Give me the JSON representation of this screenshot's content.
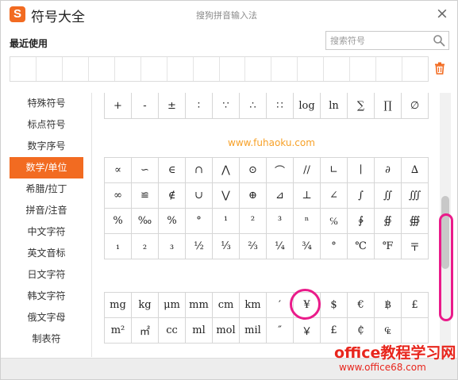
{
  "window": {
    "logo_letter": "S",
    "title": "符号大全",
    "subtitle": "搜狗拼音输入法",
    "close_symbol": "×"
  },
  "recent": {
    "label": "最近使用",
    "search_placeholder": "搜索符号"
  },
  "sidebar": {
    "items": [
      {
        "label": "特殊符号"
      },
      {
        "label": "标点符号"
      },
      {
        "label": "数字序号"
      },
      {
        "label": "数学/单位",
        "active": true
      },
      {
        "label": "希腊/拉丁"
      },
      {
        "label": "拼音/注音"
      },
      {
        "label": "中文字符"
      },
      {
        "label": "英文音标"
      },
      {
        "label": "日文字符"
      },
      {
        "label": "韩文字符"
      },
      {
        "label": "俄文字母"
      },
      {
        "label": "制表符"
      }
    ]
  },
  "symbols": {
    "row_a": [
      "+",
      "-",
      "±",
      "∶",
      "∵",
      "∴",
      "∷",
      "log",
      "ln",
      "∑",
      "∏",
      "∅"
    ],
    "watermark": "www.fuhaoku.com",
    "rows_b": [
      [
        "∝",
        "∽",
        "∈",
        "∩",
        "⋀",
        "⊙",
        "⌒",
        "//",
        "∟",
        "∣",
        "∂",
        "∆"
      ],
      [
        "∞",
        "≌",
        "∉",
        "∪",
        "⋁",
        "⊕",
        "⊿",
        "⊥",
        "∠",
        "∫",
        "∬",
        "∭"
      ],
      [
        "%",
        "‰",
        "%",
        "°",
        "¹",
        "²",
        "³",
        "ⁿ",
        "℅",
        "∲",
        "∯",
        "∰"
      ],
      [
        "₁",
        "₂",
        "₃",
        "½",
        "⅓",
        "⅔",
        "¼",
        "¾",
        "°",
        "℃",
        "℉",
        "〒"
      ]
    ],
    "rows_c": [
      [
        "mg",
        "kg",
        "μm",
        "mm",
        "cm",
        "km",
        "′",
        "¥",
        "$",
        "€",
        "฿",
        "£"
      ],
      [
        "m²",
        "㎡",
        "cc",
        "ml",
        "mol",
        "mil",
        "″",
        "￥",
        "£",
        "₵",
        "₠",
        ""
      ]
    ]
  },
  "footer": {
    "brand": "office教程学习网",
    "url": "www.office68.com"
  },
  "colors": {
    "accent": "#f26b21",
    "annotation": "#ea1b8a",
    "watermark": "#f7a128",
    "brand": "#e8261d"
  }
}
